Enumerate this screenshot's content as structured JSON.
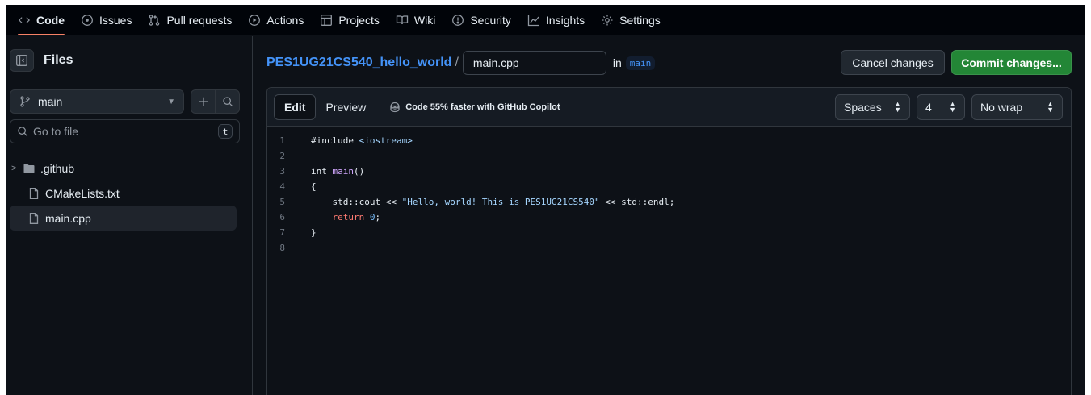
{
  "nav": {
    "tabs": [
      {
        "label": "Code",
        "icon": "code-icon",
        "active": true
      },
      {
        "label": "Issues",
        "icon": "issue-opened-icon"
      },
      {
        "label": "Pull requests",
        "icon": "git-pull-request-icon"
      },
      {
        "label": "Actions",
        "icon": "play-icon"
      },
      {
        "label": "Projects",
        "icon": "table-icon"
      },
      {
        "label": "Wiki",
        "icon": "book-icon"
      },
      {
        "label": "Security",
        "icon": "shield-icon"
      },
      {
        "label": "Insights",
        "icon": "graph-icon"
      },
      {
        "label": "Settings",
        "icon": "gear-icon"
      }
    ]
  },
  "sidebar": {
    "title": "Files",
    "branch": "main",
    "goto_placeholder": "Go to file",
    "goto_shortcut": "t",
    "tree": [
      {
        "label": ".github",
        "type": "folder"
      },
      {
        "label": "CMakeLists.txt",
        "type": "file"
      },
      {
        "label": "main.cpp",
        "type": "file",
        "selected": true
      }
    ]
  },
  "header": {
    "repo": "PES1UG21CS540_hello_world",
    "separator": "/",
    "filename": "main.cpp",
    "in_label": "in",
    "branch": "main",
    "cancel_label": "Cancel changes",
    "commit_label": "Commit changes..."
  },
  "editor": {
    "tab_edit": "Edit",
    "tab_preview": "Preview",
    "copilot_text": "Code 55% faster with GitHub Copilot",
    "indent_mode": "Spaces",
    "indent_size": "4",
    "wrap_mode": "No wrap",
    "lines": [
      {
        "n": "1",
        "text": "#include <iostream>"
      },
      {
        "n": "2",
        "text": ""
      },
      {
        "n": "3",
        "text": "int main()"
      },
      {
        "n": "4",
        "text": "{"
      },
      {
        "n": "5",
        "text": "    std::cout << \"Hello, world! This is PES1UG21CS540\" << std::endl;"
      },
      {
        "n": "6",
        "text": "    return 0;"
      },
      {
        "n": "7",
        "text": "}"
      },
      {
        "n": "8",
        "text": ""
      }
    ]
  },
  "colors": {
    "accent_blue": "#4493f8",
    "commit_green": "#238636",
    "active_tab_underline": "#f78166",
    "background": "#0d1117"
  }
}
